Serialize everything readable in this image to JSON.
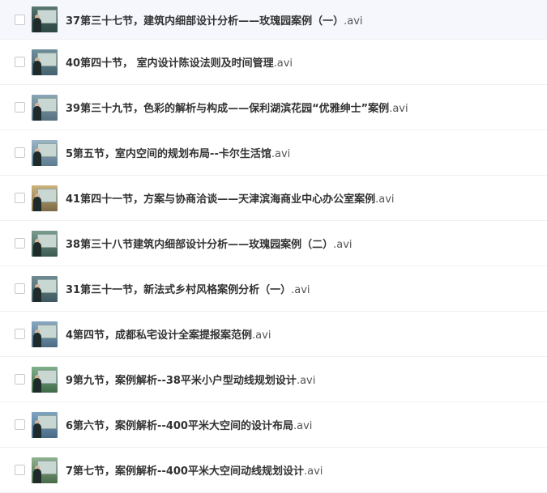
{
  "file_list": {
    "items": [
      {
        "name": "37第三十七节，建筑内细部设计分析——玫瑰园案例（一）",
        "ext": ".avi",
        "selected": false,
        "hovered": true,
        "thumb_icon": "video-thumbnail"
      },
      {
        "name": "40第四十节， 室内设计陈设法则及时间管理",
        "ext": ".avi",
        "selected": false,
        "hovered": false,
        "thumb_icon": "video-thumbnail"
      },
      {
        "name": "39第三十九节，色彩的解析与构成——保利湖滨花园“优雅绅士”案例",
        "ext": ".avi",
        "selected": false,
        "hovered": false,
        "thumb_icon": "video-thumbnail"
      },
      {
        "name": "5第五节，室内空间的规划布局--卡尔生活馆",
        "ext": ".avi",
        "selected": false,
        "hovered": false,
        "thumb_icon": "video-thumbnail"
      },
      {
        "name": "41第四十一节，方案与协商洽谈——天津滨海商业中心办公室案例",
        "ext": ".avi",
        "selected": false,
        "hovered": false,
        "thumb_icon": "video-thumbnail"
      },
      {
        "name": "38第三十八节建筑内细部设计分析——玫瑰园案例（二）",
        "ext": ".avi",
        "selected": false,
        "hovered": false,
        "thumb_icon": "video-thumbnail"
      },
      {
        "name": "31第三十一节，新法式乡村风格案例分析（一）",
        "ext": ".avi",
        "selected": false,
        "hovered": false,
        "thumb_icon": "video-thumbnail"
      },
      {
        "name": "4第四节，成都私宅设计全案提报案范例",
        "ext": ".avi",
        "selected": false,
        "hovered": false,
        "thumb_icon": "video-thumbnail"
      },
      {
        "name": "9第九节，案例解析--38平米小户型动线规划设计",
        "ext": ".avi",
        "selected": false,
        "hovered": false,
        "thumb_icon": "video-thumbnail"
      },
      {
        "name": "6第六节，案例解析--400平米大空间的设计布局",
        "ext": ".avi",
        "selected": false,
        "hovered": false,
        "thumb_icon": "video-thumbnail"
      },
      {
        "name": "7第七节，案例解析--400平米大空间动线规划设计",
        "ext": ".avi",
        "selected": false,
        "hovered": false,
        "thumb_icon": "video-thumbnail"
      }
    ]
  },
  "colors": {
    "hover_row_bg": "#f5f7fd",
    "divider": "#f0f0f0",
    "text": "#333333",
    "checkbox_border": "#c8c8c8"
  }
}
